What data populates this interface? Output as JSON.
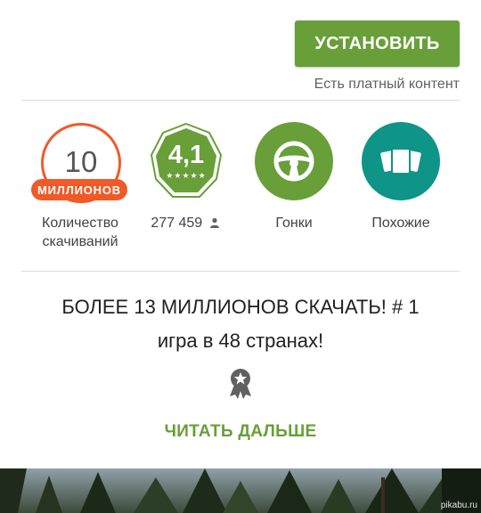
{
  "install": {
    "label": "УСТАНОВИТЬ"
  },
  "paid_note": "Есть платный контент",
  "stats": {
    "downloads": {
      "value": "10",
      "badge": "МИЛЛИОНОВ",
      "label_line1": "Количество",
      "label_line2": "скачиваний"
    },
    "rating": {
      "value": "4,1",
      "count": "277 459"
    },
    "category": {
      "label": "Гонки",
      "icon": "steering-wheel-icon"
    },
    "similar": {
      "label": "Похожие",
      "icon": "cards-icon"
    }
  },
  "description": {
    "line1": "БОЛЕЕ 13 МИЛЛИОНОВ СКАЧАТЬ! # 1",
    "line2": "игра в 48 странах!"
  },
  "read_more": "ЧИТАТЬ ДАЛЬШЕ",
  "watermark": "pikabu.ru",
  "colors": {
    "accent_green": "#689f38",
    "downloads_orange": "#f05a28",
    "similar_teal": "#0f9488"
  }
}
